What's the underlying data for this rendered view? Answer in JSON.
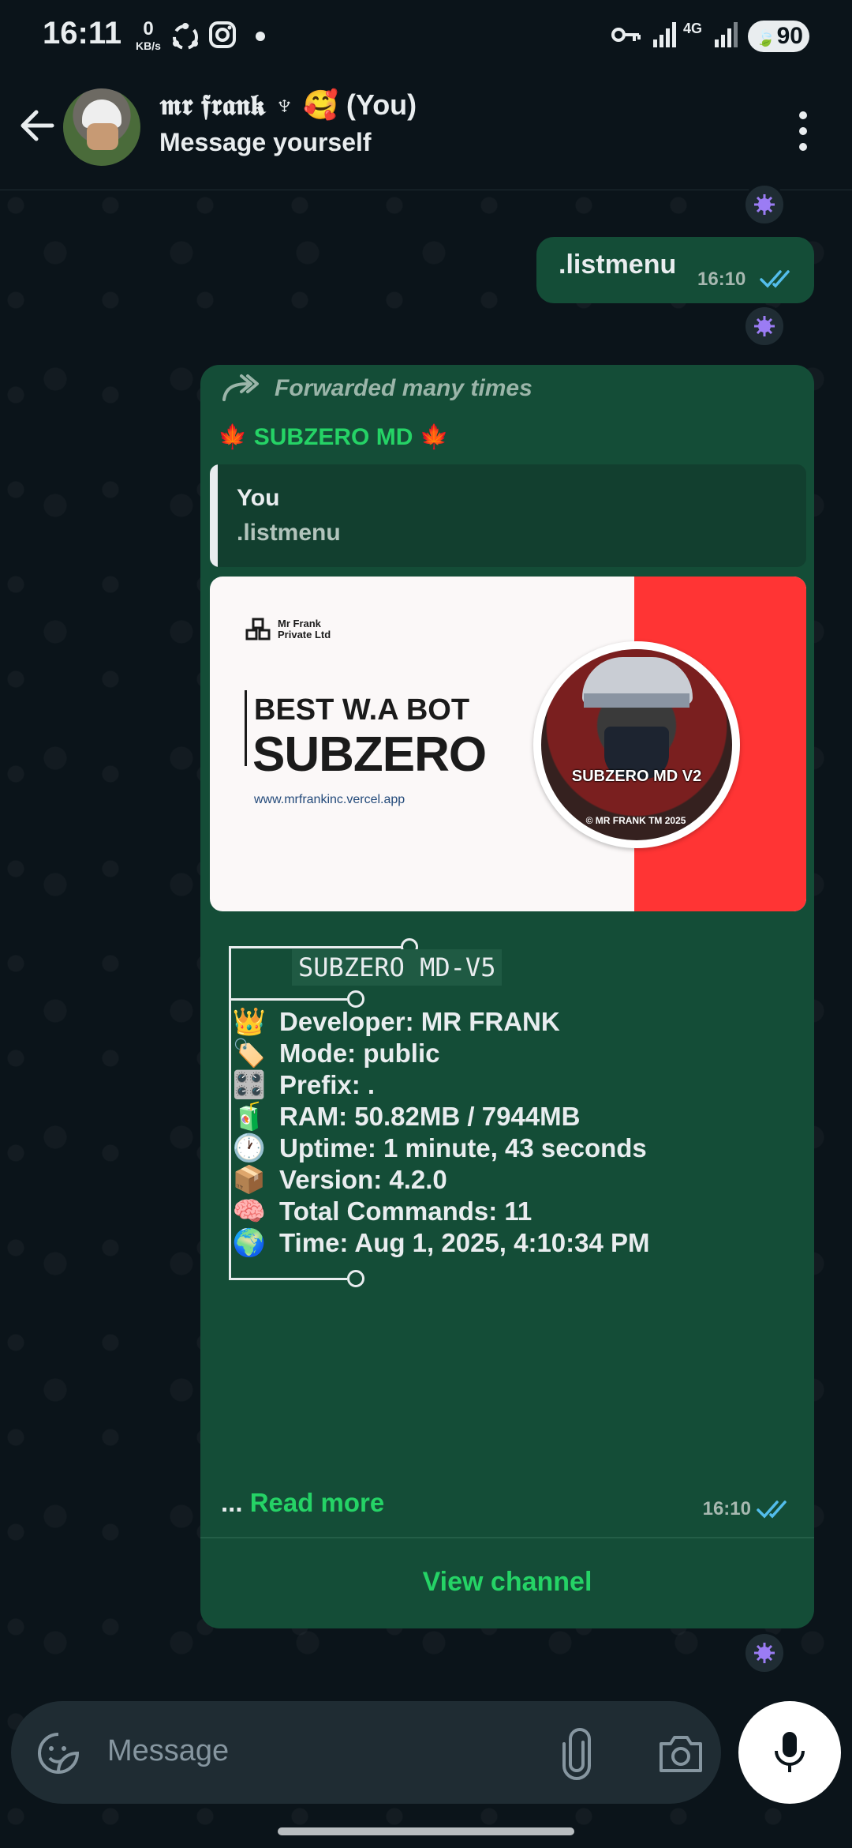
{
  "status_bar": {
    "time": "16:11",
    "net_speed_value": "0",
    "net_speed_unit": "KB/s",
    "network_label": "4G",
    "battery": "90"
  },
  "header": {
    "contact_name": "𝖒𝖗 𝖋𝖗𝖆𝖓𝖐 ♆ 🥰 (You)",
    "subtitle": "Message yourself"
  },
  "messages": {
    "outgoing": {
      "text": ".listmenu",
      "time": "16:10"
    },
    "bot": {
      "forwarded_label": "Forwarded many times",
      "sender": "🍁 SUBZERO MD 🍁",
      "quote_author": "You",
      "quote_text": ".listmenu",
      "banner": {
        "brand_line1": "Mr Frank",
        "brand_line2": "Private Ltd",
        "headline": "BEST W.A BOT",
        "title": "SUBZERO",
        "url": "www.mrfrankinc.vercel.app",
        "badge_text": "SUBZERO MD  V2",
        "badge_copyright": "© MR FRANK TM 2025"
      },
      "box_title": "SUBZERO MD-V5",
      "rows": [
        {
          "emoji": "👑",
          "text": "Developer: MR FRANK"
        },
        {
          "emoji": "🏷️",
          "text": "Mode: public"
        },
        {
          "emoji": "🎛️",
          "text": "Prefix: ."
        },
        {
          "emoji": "🧃",
          "text": "RAM: 50.82MB / 7944MB"
        },
        {
          "emoji": "🕐",
          "text": "Uptime: 1 minute, 43 seconds"
        },
        {
          "emoji": "📦",
          "text": "Version: 4.2.0"
        },
        {
          "emoji": "🧠",
          "text": "Total Commands: 11"
        },
        {
          "emoji": "🌍",
          "text": "Time: Aug 1, 2025, 4:10:34 PM"
        }
      ],
      "read_more_prefix": "... ",
      "read_more": "Read more",
      "time": "16:10",
      "view_channel": "View channel"
    }
  },
  "input": {
    "placeholder": "Message"
  },
  "colors": {
    "accent": "#25d366",
    "bubble": "#144d37",
    "background": "#0b141a",
    "tick_read": "#53bdeb"
  }
}
